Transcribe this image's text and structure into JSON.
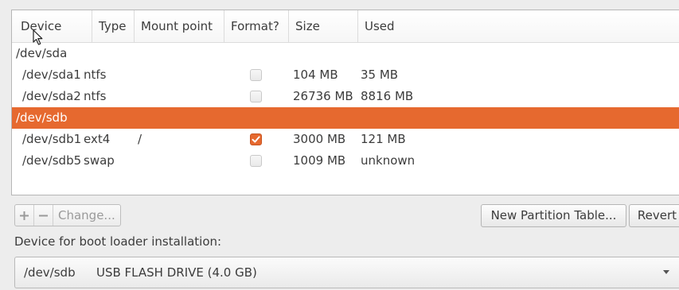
{
  "table": {
    "columns": [
      "Device",
      "Type",
      "Mount point",
      "Format?",
      "Size",
      "Used"
    ],
    "rows": [
      {
        "device": "/dev/sda",
        "type": "",
        "mount": "",
        "format": null,
        "size": "",
        "used": "",
        "disk": true,
        "selected": false
      },
      {
        "device": "/dev/sda1",
        "type": "ntfs",
        "mount": "",
        "format": false,
        "size": "104 MB",
        "used": "35 MB",
        "disk": false,
        "selected": false
      },
      {
        "device": "/dev/sda2",
        "type": "ntfs",
        "mount": "",
        "format": false,
        "size": "26736 MB",
        "used": "8816 MB",
        "disk": false,
        "selected": false
      },
      {
        "device": "/dev/sdb",
        "type": "",
        "mount": "",
        "format": null,
        "size": "",
        "used": "",
        "disk": true,
        "selected": true
      },
      {
        "device": "/dev/sdb1",
        "type": "ext4",
        "mount": "/",
        "format": true,
        "size": "3000 MB",
        "used": "121 MB",
        "disk": false,
        "selected": false
      },
      {
        "device": "/dev/sdb5",
        "type": "swap",
        "mount": "",
        "format": false,
        "size": "1009 MB",
        "used": "unknown",
        "disk": false,
        "selected": false
      }
    ]
  },
  "toolbar": {
    "add_icon": "plus-icon",
    "remove_icon": "minus-icon",
    "change_label": "Change...",
    "new_partition_table_label": "New Partition Table...",
    "revert_label": "Revert"
  },
  "bootloader": {
    "label": "Device for boot loader installation:",
    "selected_device": "/dev/sdb",
    "selected_description": "USB FLASH DRIVE (4.0 GB)"
  },
  "colors": {
    "selection": "#e6692f",
    "check_on": "#e6692f"
  }
}
